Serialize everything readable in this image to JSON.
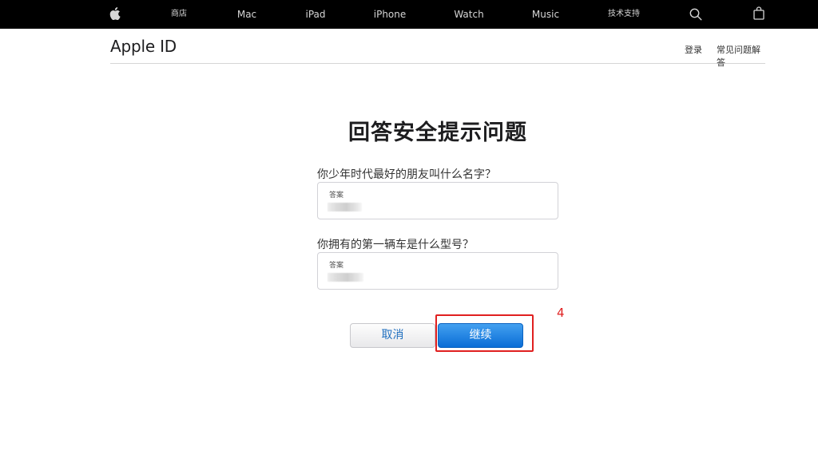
{
  "global_nav": {
    "items": [
      "商店",
      "Mac",
      "iPad",
      "iPhone",
      "Watch",
      "Music",
      "技术支持"
    ],
    "icons": [
      "apple-logo-icon",
      "search-icon",
      "bag-icon"
    ]
  },
  "local_nav": {
    "title": "Apple ID",
    "links": [
      "登录",
      "常见问题解答"
    ]
  },
  "main": {
    "title": "回答安全提示问题",
    "questions": [
      {
        "label": "你少年时代最好的朋友叫什么名字？",
        "field_label": "答案",
        "value": "••••"
      },
      {
        "label": "你拥有的第一辆车是什么型号？",
        "field_label": "答案",
        "value": "••••"
      }
    ],
    "buttons": {
      "cancel": "取消",
      "continue": "继续"
    }
  },
  "annotation": {
    "number": "4",
    "color": "#e02020"
  },
  "colors": {
    "accent": "#0a6dd6",
    "nav_bg": "#000000",
    "link": "#1f6fbf"
  }
}
